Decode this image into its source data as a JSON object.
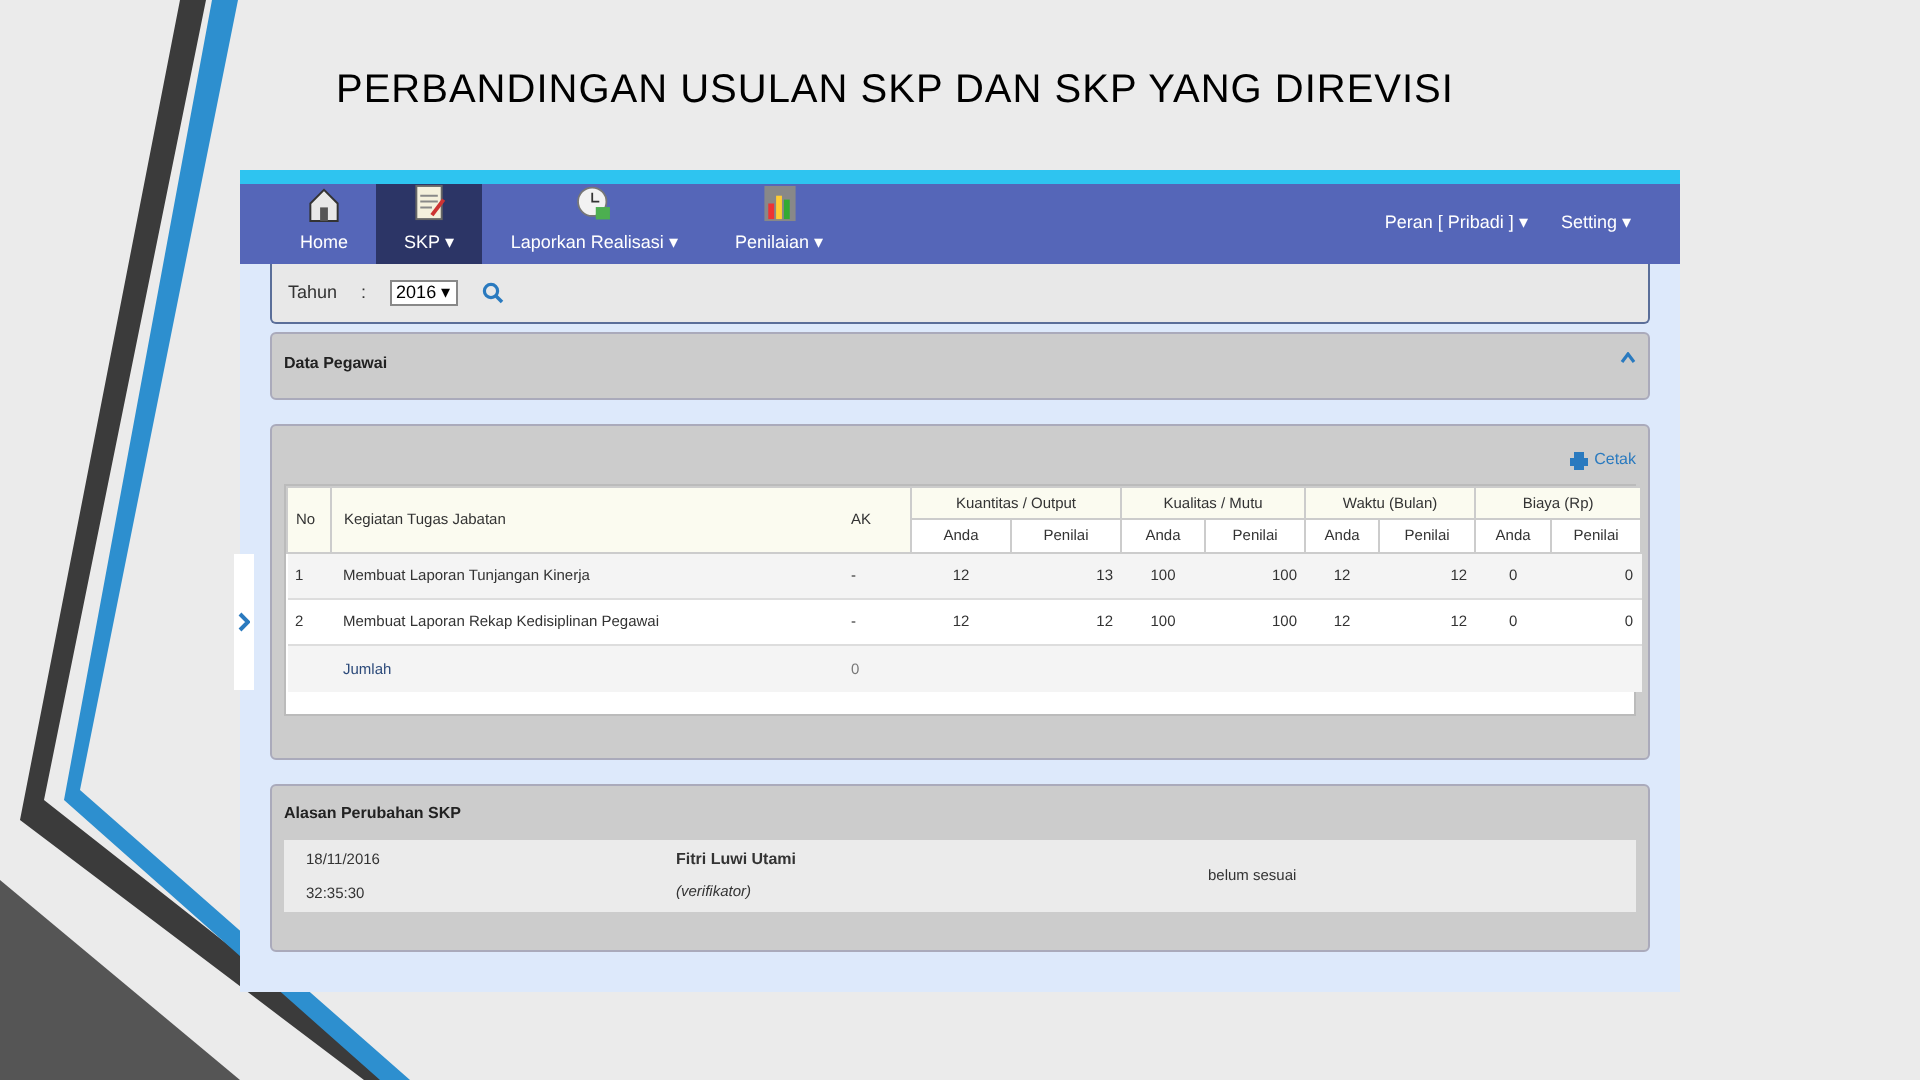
{
  "slide_title": "PERBANDINGAN USULAN SKP DAN SKP YANG DIREVISI",
  "navbar": {
    "items": [
      {
        "label": "Home",
        "selected": false
      },
      {
        "label": "SKP",
        "caret": "▾",
        "selected": true
      },
      {
        "label": "Laporkan Realisasi",
        "caret": "▾",
        "selected": false
      },
      {
        "label": "Penilaian",
        "caret": "▾",
        "selected": false
      }
    ],
    "right_items": [
      {
        "label": "Peran [ Pribadi ]",
        "caret": "▾"
      },
      {
        "label": "Setting",
        "caret": "▾"
      }
    ]
  },
  "filter": {
    "label": "Tahun",
    "separator": ":",
    "value": "2016",
    "caret": "▾"
  },
  "data_pegawai": {
    "title": "Data Pegawai",
    "expanded": true
  },
  "table": {
    "print_label": "Cetak",
    "columns": [
      "No",
      "Kegiatan Tugas Jabatan",
      "AK"
    ],
    "groups": [
      {
        "label": "Kuantitas / Output",
        "subcolumns": [
          "Anda",
          "Penilai"
        ]
      },
      {
        "label": "Kualitas / Mutu",
        "subcolumns": [
          "Anda",
          "Penilai"
        ]
      },
      {
        "label": "Waktu (Bulan)",
        "subcolumns": [
          "Anda",
          "Penilai"
        ]
      },
      {
        "label": "Biaya (Rp)",
        "subcolumns": [
          "Anda",
          "Penilai"
        ]
      }
    ],
    "rows": [
      [
        "1",
        "Membuat Laporan Tunjangan Kinerja",
        "-",
        "12",
        "13",
        "100",
        "100",
        "12",
        "12",
        "0",
        "0"
      ],
      [
        "2",
        "Membuat Laporan Rekap Kedisiplinan Pegawai",
        "-",
        "12",
        "12",
        "100",
        "100",
        "12",
        "12",
        "0",
        "0"
      ]
    ],
    "total": {
      "label": "Jumlah",
      "value": "0"
    }
  },
  "alasan": {
    "title": "Alasan Perubahan SKP",
    "entries": [
      {
        "date": "18/11/2016",
        "time": "32:35:30",
        "name": "Fitri Luwi Utami",
        "role": "(verifikator)",
        "reason": "belum sesuai"
      }
    ]
  }
}
